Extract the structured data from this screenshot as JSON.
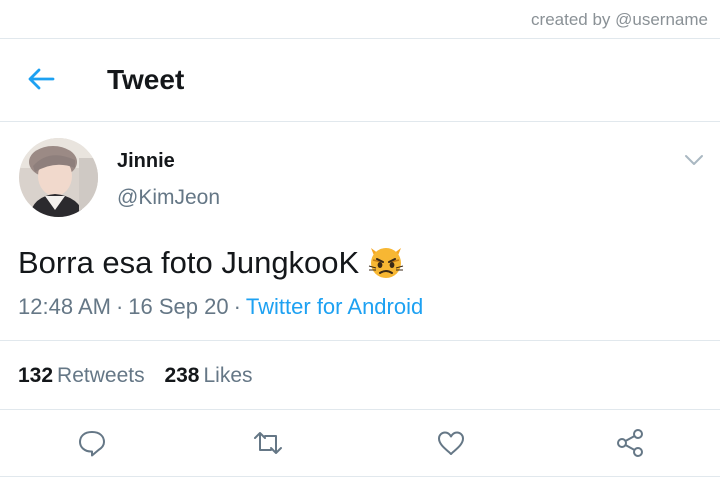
{
  "top_bar": {
    "credit": "created by @username"
  },
  "header": {
    "title": "Tweet",
    "back_icon": "arrow-left-icon"
  },
  "tweet": {
    "display_name": "Jinnie",
    "handle": "@KimJeon",
    "text": "Borra esa foto JungkooK",
    "emoji": "pouting-cat-face",
    "time": "12:48 AM",
    "date": "16 Sep 20",
    "separator": "·",
    "source": "Twitter for Android"
  },
  "stats": {
    "retweets_count": "132",
    "retweets_label": "Retweets",
    "likes_count": "238",
    "likes_label": "Likes"
  },
  "actions": [
    "reply-icon",
    "retweet-icon",
    "like-icon",
    "share-icon"
  ],
  "colors": {
    "accent": "#1da1f2",
    "text": "#14171a",
    "secondary": "#657786",
    "divider": "#e1e8ed"
  }
}
